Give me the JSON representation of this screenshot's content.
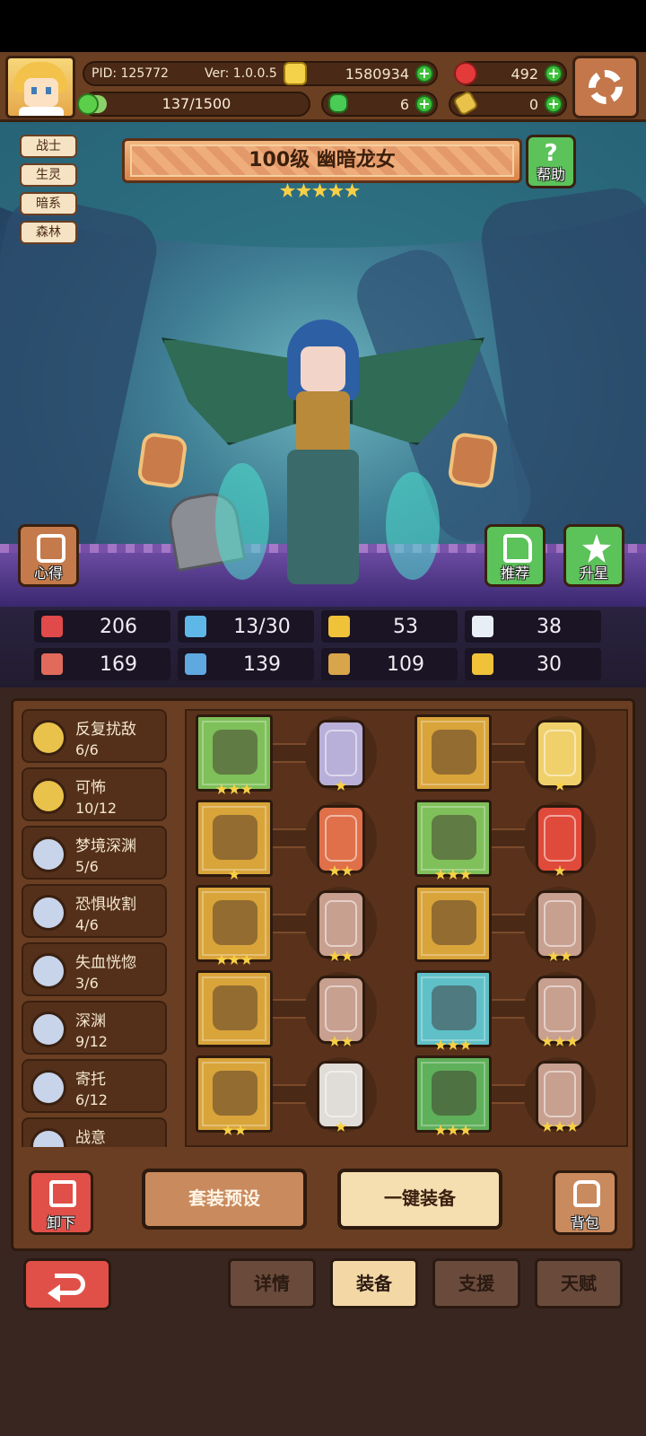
{
  "header": {
    "pid": "PID: 125772",
    "version": "Ver: 1.0.0.5",
    "gold": "1580934",
    "gems": "492",
    "clover": "6",
    "key": "0",
    "xp": "137/1500",
    "xp_progress": 0.0913
  },
  "tags": [
    "战士",
    "生灵",
    "暗系",
    "森林"
  ],
  "hero": {
    "title": "100级 幽暗龙女",
    "stars": 5
  },
  "buttons": {
    "help": "帮助",
    "tips": "心得",
    "recommend": "推荐",
    "star_up": "升星"
  },
  "stats": [
    {
      "icon": "heart-icon",
      "value": "206",
      "color": "#e04a4a"
    },
    {
      "icon": "droplet-icon",
      "value": "13/30",
      "color": "#5fb7e8"
    },
    {
      "icon": "shield-icon",
      "value": "53",
      "color": "#f0c23a"
    },
    {
      "icon": "wing-icon",
      "value": "38",
      "color": "#e8eef5"
    },
    {
      "icon": "fist-icon",
      "value": "169",
      "color": "#e26a5a"
    },
    {
      "icon": "book-icon",
      "value": "139",
      "color": "#5fa8e0"
    },
    {
      "icon": "boot-icon",
      "value": "109",
      "color": "#d8a54a"
    },
    {
      "icon": "horseshoe-icon",
      "value": "30",
      "color": "#f0c23a"
    }
  ],
  "sets": [
    {
      "name": "反复扰敌",
      "count": "6/6",
      "medal": "gold"
    },
    {
      "name": "可怖",
      "count": "10/12",
      "medal": "gold"
    },
    {
      "name": "梦境深渊",
      "count": "5/6",
      "medal": "silver"
    },
    {
      "name": "恐惧收割",
      "count": "4/6",
      "medal": "silver"
    },
    {
      "name": "失血恍惚",
      "count": "3/6",
      "medal": "silver"
    },
    {
      "name": "深渊",
      "count": "9/12",
      "medal": "silver"
    },
    {
      "name": "寄托",
      "count": "6/12",
      "medal": "silver"
    },
    {
      "name": "战意",
      "count": "",
      "medal": "silver"
    }
  ],
  "equipment": [
    {
      "item": "spear-icon",
      "bg": "#7fc05a",
      "stars": 3,
      "rune": "#b8b0d8",
      "rune_stars": 1
    },
    {
      "item": "hood-icon",
      "bg": "#d9a43a",
      "stars": 0,
      "rune": "#f0d06a",
      "rune_stars": 1
    },
    {
      "item": "bear-icon",
      "bg": "#d9a43a",
      "stars": 1,
      "rune": "#e0704a",
      "rune_stars": 2
    },
    {
      "item": "cloak-icon",
      "bg": "#7fc05a",
      "stars": 3,
      "rune": "#e04a3a",
      "rune_stars": 1
    },
    {
      "item": "heart-amulet-icon",
      "bg": "#d9a43a",
      "stars": 3,
      "rune": "#c8a090",
      "rune_stars": 2
    },
    {
      "item": "armor-icon",
      "bg": "#d9a43a",
      "stars": 0,
      "rune": "#c8a090",
      "rune_stars": 2
    },
    {
      "item": "stone-icon",
      "bg": "#d9a43a",
      "stars": 0,
      "rune": "#c8a090",
      "rune_stars": 2
    },
    {
      "item": "ring-icon",
      "bg": "#5fc0c8",
      "stars": 3,
      "rune": "#c8a090",
      "rune_stars": 3
    },
    {
      "item": "charm-icon",
      "bg": "#d9a43a",
      "stars": 2,
      "rune": "#e0dcd8",
      "rune_stars": 1
    },
    {
      "item": "boots-icon",
      "bg": "#5fb05a",
      "stars": 3,
      "rune": "#c8a090",
      "rune_stars": 3
    }
  ],
  "actions": {
    "unequip": "卸下",
    "preset": "套装预设",
    "auto_equip": "一键装备",
    "bag": "背包"
  },
  "nav": {
    "details": "详情",
    "equip": "装备",
    "support": "支援",
    "talent": "天赋"
  }
}
